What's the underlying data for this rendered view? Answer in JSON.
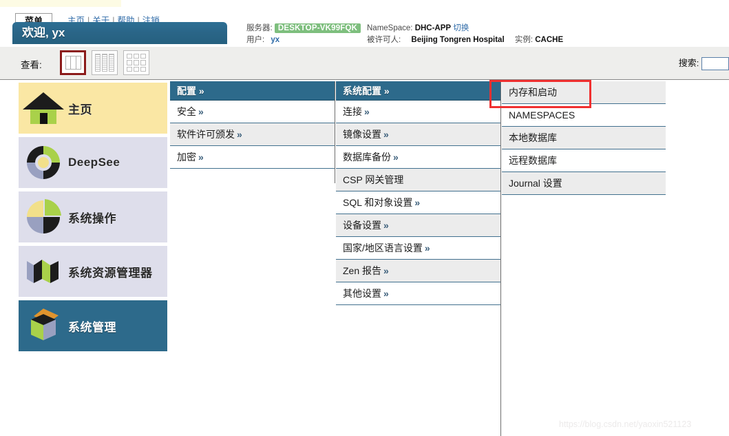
{
  "header": {
    "menu_button": "菜单",
    "links": [
      "主页",
      "关于",
      "帮助",
      "注销"
    ],
    "welcome": "欢迎, yx"
  },
  "server_info": {
    "server_label": "服务器:",
    "server_value": "DESKTOP-VK99FQK",
    "user_label": "用户:",
    "user_value": "yx",
    "namespace_label": "NameSpace:",
    "namespace_value": "DHC-APP",
    "namespace_switch": "切换",
    "licensee_label": "被许可人:",
    "licensee_value": "Beijing Tongren Hospital",
    "instance_label": "实例:",
    "instance_value": "CACHE"
  },
  "toolbar": {
    "view_label": "查看:",
    "view_icons": [
      "columns-view-icon",
      "list-view-icon",
      "grid-view-icon"
    ],
    "selected_view_index": 0,
    "search_label": "搜索:",
    "search_value": "",
    "search_placeholder": ""
  },
  "sidebar": {
    "items": [
      {
        "label": "主页",
        "icon": "home-icon",
        "state": "home"
      },
      {
        "label": "DeepSee",
        "icon": "deepsee-donut-icon",
        "state": "normal"
      },
      {
        "label": "系统操作",
        "icon": "pie-chart-icon",
        "state": "normal"
      },
      {
        "label": "系统资源管理器",
        "icon": "explorer-zigzag-icon",
        "state": "normal"
      },
      {
        "label": "系统管理",
        "icon": "cube-box-icon",
        "state": "selected"
      }
    ]
  },
  "columns": [
    {
      "header": "配置 »",
      "rows": [
        {
          "label": "安全",
          "chevron": "»"
        },
        {
          "label": "软件许可颁发",
          "chevron": "»"
        },
        {
          "label": "加密",
          "chevron": "»"
        }
      ]
    },
    {
      "header": "系统配置 »",
      "rows": [
        {
          "label": "连接",
          "chevron": "»"
        },
        {
          "label": "镜像设置",
          "chevron": "»"
        },
        {
          "label": "数据库备份",
          "chevron": "»"
        },
        {
          "label": "CSP 网关管理",
          "chevron": ""
        },
        {
          "label": "SQL 和对象设置",
          "chevron": "»"
        },
        {
          "label": "设备设置",
          "chevron": "»"
        },
        {
          "label": "国家/地区语言设置",
          "chevron": "»"
        },
        {
          "label": "Zen 报告",
          "chevron": "»"
        },
        {
          "label": "其他设置",
          "chevron": "»"
        }
      ]
    },
    {
      "header": "",
      "rows": [
        {
          "label": "内存和启动",
          "chevron": "",
          "highlighted": true
        },
        {
          "label": "NAMESPACES",
          "chevron": ""
        },
        {
          "label": "本地数据库",
          "chevron": ""
        },
        {
          "label": "远程数据库",
          "chevron": ""
        },
        {
          "label": "Journal 设置",
          "chevron": ""
        }
      ]
    }
  ],
  "annotation": {
    "target": "内存和启动",
    "color": "#f03030"
  },
  "watermark": "https://blog.csdn.net/yaoxin521123",
  "colors": {
    "header_teal": "#2d6a8b",
    "home_yellow": "#fae7a4",
    "sidebar_lavender": "#dedeeb",
    "badge_green": "#7ebf7e",
    "link_blue": "#2f6ba8",
    "row_alt": "#ececec",
    "toolbar_bg": "#eeeeec",
    "selected_view_border": "#8b1a1a"
  }
}
